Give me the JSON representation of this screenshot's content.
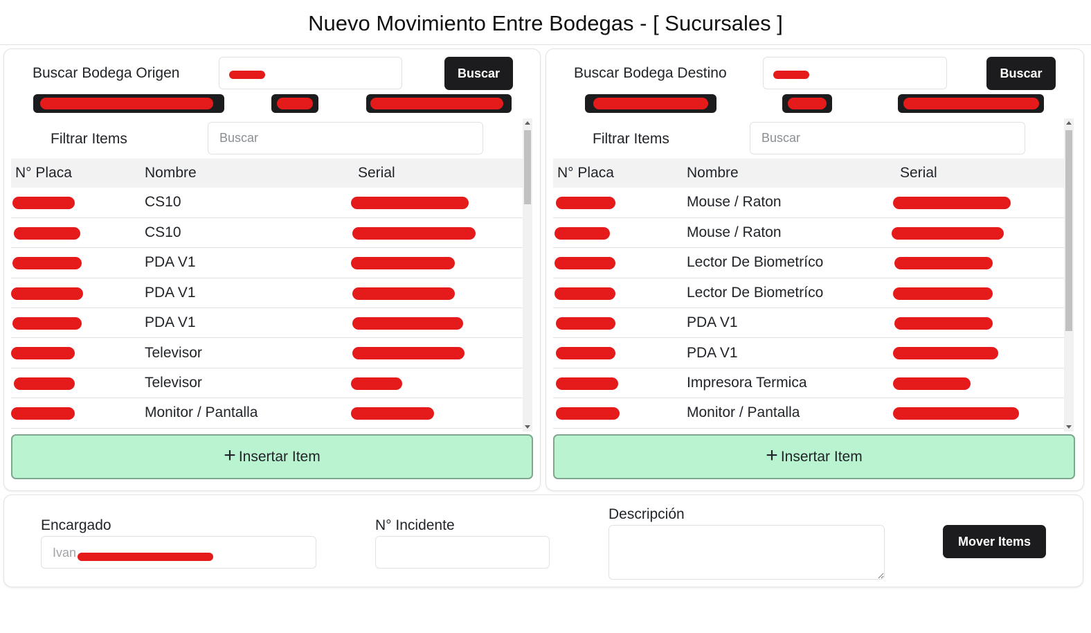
{
  "title": "Nuevo Movimiento Entre Bodegas - [ Sucursales ]",
  "origin": {
    "search_label": "Buscar Bodega Origen",
    "search_button": "Buscar",
    "filter_label": "Filtrar Items",
    "filter_placeholder": "Buscar",
    "columns": [
      "N° Placa",
      "Nombre",
      "Serial"
    ],
    "rows": [
      {
        "nombre": "CS10"
      },
      {
        "nombre": "CS10"
      },
      {
        "nombre": "PDA V1"
      },
      {
        "nombre": "PDA V1"
      },
      {
        "nombre": "PDA V1"
      },
      {
        "nombre": "Televisor"
      },
      {
        "nombre": "Televisor"
      },
      {
        "nombre": "Monitor / Pantalla"
      }
    ],
    "insert_label": "Insertar Item"
  },
  "dest": {
    "search_label": "Buscar Bodega Destino",
    "search_button": "Buscar",
    "filter_label": "Filtrar Items",
    "filter_placeholder": "Buscar",
    "columns": [
      "N° Placa",
      "Nombre",
      "Serial"
    ],
    "rows": [
      {
        "nombre": "Mouse / Raton"
      },
      {
        "nombre": "Mouse / Raton"
      },
      {
        "nombre": "Lector De Biometríco"
      },
      {
        "nombre": "Lector De Biometríco"
      },
      {
        "nombre": "PDA V1"
      },
      {
        "nombre": "PDA V1"
      },
      {
        "nombre": "Impresora Termica"
      },
      {
        "nombre": "Monitor / Pantalla"
      }
    ],
    "insert_label": "Insertar Item"
  },
  "footer": {
    "encargado_label": "Encargado",
    "encargado_value": "Ivan",
    "incidente_label": "N° Incidente",
    "descripcion_label": "Descripción",
    "move_button": "Mover Items"
  },
  "colors": {
    "accent_dark": "#1c1c1e",
    "insert_green": "#b9f3d0",
    "redaction": "#e51b1b"
  }
}
